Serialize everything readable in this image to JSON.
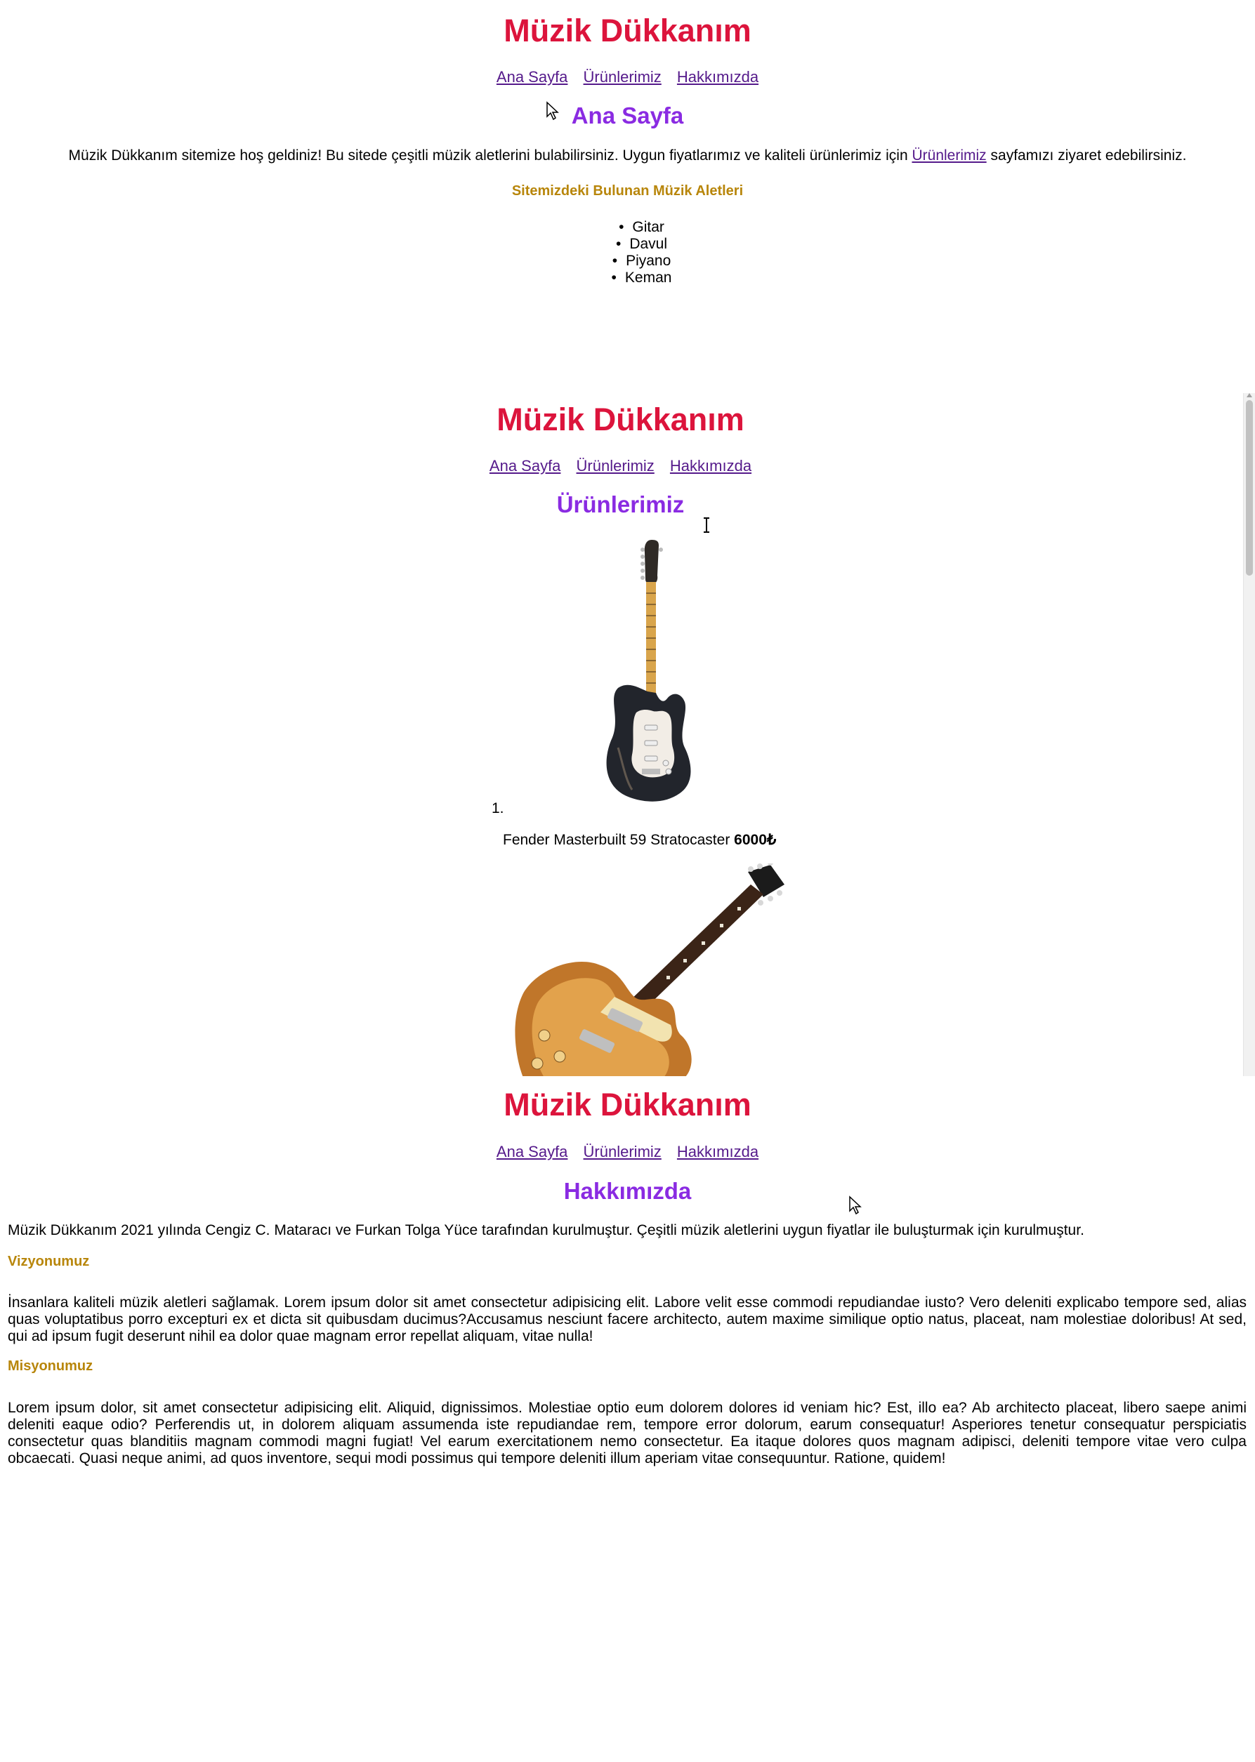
{
  "site": {
    "title": "Müzik Dükkanım"
  },
  "nav": {
    "home": "Ana Sayfa",
    "products": "Ürünlerimiz",
    "about": "Hakkımızda"
  },
  "home": {
    "heading": "Ana Sayfa",
    "intro_before": "Müzik Dükkanım sitemize hoş geldiniz! Bu sitede çeşitli müzik aletlerini bulabilirsiniz. Uygun fiyatlarımız ve kaliteli ürünlerimiz için",
    "intro_link": "Ürünlerimiz",
    "intro_after": "sayfamızı ziyaret edebilirsiniz.",
    "list_heading": "Sitemizdeki Bulunan Müzik Aletleri",
    "instruments": [
      "Gitar",
      "Davul",
      "Piyano",
      "Keman"
    ]
  },
  "products": {
    "heading": "Ürünlerimiz",
    "items": [
      {
        "number": "1.",
        "name": "Fender Masterbuilt 59 Stratocaster",
        "price": "6000₺",
        "image": "stratocaster-guitar-image"
      },
      {
        "image": "les-paul-guitar-image"
      }
    ]
  },
  "about": {
    "heading": "Hakkımızda",
    "intro": "Müzik Dükkanım 2021 yılında Cengiz C. Mataracı ve Furkan Tolga Yüce tarafından kurulmuştur. Çeşitli müzik aletlerini uygun fiyatlar ile buluşturmak için kurulmuştur.",
    "vision_heading": "Vizyonumuz",
    "vision_text": "İnsanlara kaliteli müzik aletleri sağlamak. Lorem ipsum dolor sit amet consectetur adipisicing elit. Labore velit esse commodi repudiandae iusto? Vero deleniti explicabo tempore sed, alias quas voluptatibus porro excepturi ex et dicta sit quibusdam ducimus?Accusamus nesciunt facere architecto, autem maxime similique optio natus, placeat, nam molestiae doloribus! At sed, qui ad ipsum fugit deserunt nihil ea dolor quae magnam error repellat aliquam, vitae nulla!",
    "mission_heading": "Misyonumuz",
    "mission_text": "Lorem ipsum dolor, sit amet consectetur adipisicing elit. Aliquid, dignissimos. Molestiae optio eum dolorem dolores id veniam hic? Est, illo ea? Ab architecto placeat, libero saepe animi deleniti eaque odio? Perferendis ut, in dolorem aliquam assumenda iste repudiandae rem, tempore error dolorum, earum consequatur! Asperiores tenetur consequatur perspiciatis consectetur quas blanditiis magnam commodi magni fugiat! Vel earum exercitationem nemo consectetur. Ea itaque dolores quos magnam adipisci, deleniti tempore vitae vero culpa obcaecati. Quasi neque animi, ad quos inventore, sequi modi possimus qui tempore deleniti illum aperiam vitae consequuntur. Ratione, quidem!"
  },
  "colors": {
    "title": "#dc143c",
    "page_heading": "#8a2be2",
    "section_heading": "#b8860b",
    "link": "#551a8b"
  },
  "icons": [
    "arrow-cursor-icon",
    "text-cursor-icon"
  ]
}
